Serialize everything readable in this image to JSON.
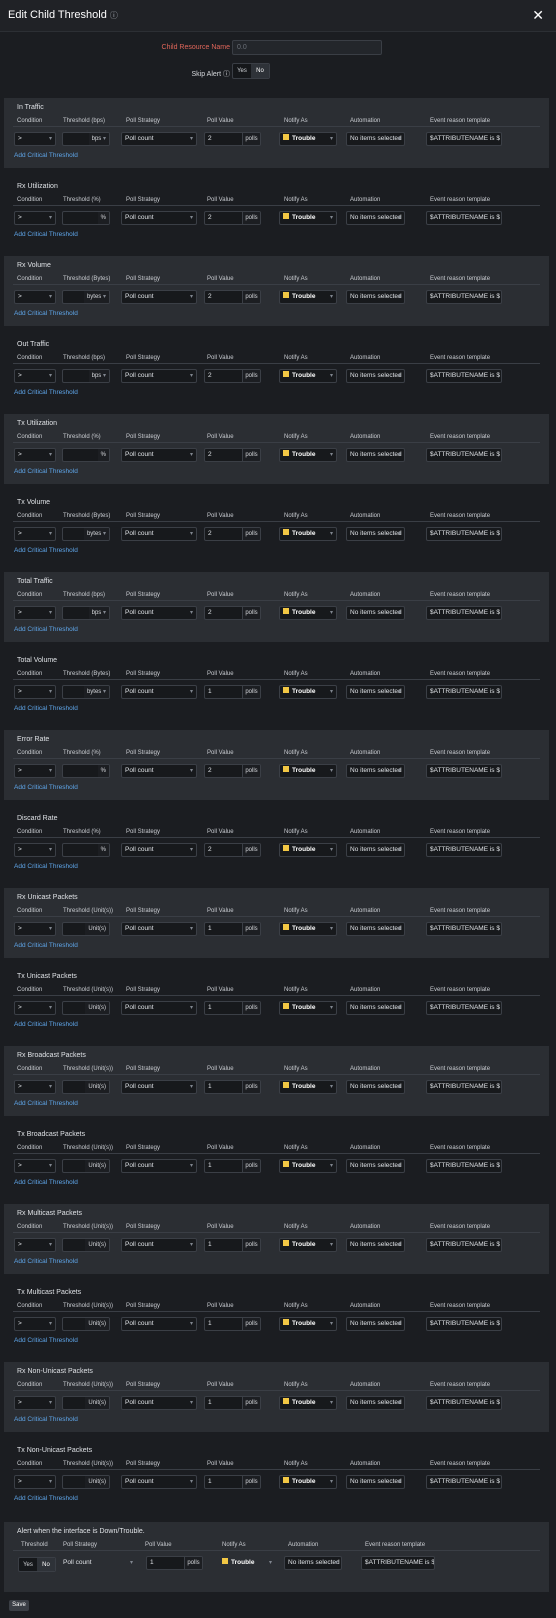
{
  "dialog": {
    "title": "Edit Child Threshold",
    "info_icon": "ⓘ",
    "close_icon": "✕"
  },
  "form": {
    "child_resource_name_label": "Child Resource Name",
    "child_resource_name_value": "0.0",
    "skip_alert_label": "Skip Alert",
    "skip_alert_options": [
      "Yes",
      "No"
    ],
    "skip_alert_selected": "No"
  },
  "columns": {
    "condition": "Condition",
    "poll_strategy": "Poll Strategy",
    "poll_value": "Poll Value",
    "notify_as": "Notify As",
    "automation": "Automation",
    "event_template": "Event reason template"
  },
  "row_defaults": {
    "condition": ">",
    "poll_strategy": "Poll count",
    "polls_unit": "polls",
    "notify_as": "Trouble",
    "notify_color": "#f2c744",
    "automation": "No items selected",
    "event_template": "$ATTRIBUTENAME is $",
    "add_link": "Add Critical Threshold"
  },
  "sections": [
    {
      "title": "In Traffic",
      "threshold_label": "Threshold (bps)",
      "unit": "bps",
      "unit_dropdown": true,
      "poll_value": "2"
    },
    {
      "title": "Rx Utilization",
      "threshold_label": "Threshold (%)",
      "unit": "%",
      "unit_dropdown": false,
      "poll_value": "2"
    },
    {
      "title": "Rx Volume",
      "threshold_label": "Threshold (Bytes)",
      "unit": "bytes",
      "unit_dropdown": true,
      "poll_value": "2"
    },
    {
      "title": "Out Traffic",
      "threshold_label": "Threshold (bps)",
      "unit": "bps",
      "unit_dropdown": true,
      "poll_value": "2"
    },
    {
      "title": "Tx Utilization",
      "threshold_label": "Threshold (%)",
      "unit": "%",
      "unit_dropdown": false,
      "poll_value": "2"
    },
    {
      "title": "Tx Volume",
      "threshold_label": "Threshold (Bytes)",
      "unit": "bytes",
      "unit_dropdown": true,
      "poll_value": "2"
    },
    {
      "title": "Total Traffic",
      "threshold_label": "Threshold (bps)",
      "unit": "bps",
      "unit_dropdown": true,
      "poll_value": "2"
    },
    {
      "title": "Total Volume",
      "threshold_label": "Threshold (Bytes)",
      "unit": "bytes",
      "unit_dropdown": true,
      "poll_value": "1"
    },
    {
      "title": "Error Rate",
      "threshold_label": "Threshold (%)",
      "unit": "%",
      "unit_dropdown": false,
      "poll_value": "2"
    },
    {
      "title": "Discard Rate",
      "threshold_label": "Threshold (%)",
      "unit": "%",
      "unit_dropdown": false,
      "poll_value": "2"
    },
    {
      "title": "Rx Unicast Packets",
      "threshold_label": "Threshold (Unit(s))",
      "unit": "Unit(s)",
      "unit_dropdown": false,
      "poll_value": "1"
    },
    {
      "title": "Tx Unicast Packets",
      "threshold_label": "Threshold (Unit(s))",
      "unit": "Unit(s)",
      "unit_dropdown": false,
      "poll_value": "1"
    },
    {
      "title": "Rx Broadcast Packets",
      "threshold_label": "Threshold (Unit(s))",
      "unit": "Unit(s)",
      "unit_dropdown": false,
      "poll_value": "1"
    },
    {
      "title": "Tx Broadcast Packets",
      "threshold_label": "Threshold (Unit(s))",
      "unit": "Unit(s)",
      "unit_dropdown": false,
      "poll_value": "1"
    },
    {
      "title": "Rx Multicast Packets",
      "threshold_label": "Threshold (Unit(s))",
      "unit": "Unit(s)",
      "unit_dropdown": false,
      "poll_value": "1"
    },
    {
      "title": "Tx Multicast Packets",
      "threshold_label": "Threshold (Unit(s))",
      "unit": "Unit(s)",
      "unit_dropdown": false,
      "poll_value": "1"
    },
    {
      "title": "Rx Non-Unicast Packets",
      "threshold_label": "Threshold (Unit(s))",
      "unit": "Unit(s)",
      "unit_dropdown": false,
      "poll_value": "1"
    },
    {
      "title": "Tx Non-Unicast Packets",
      "threshold_label": "Threshold (Unit(s))",
      "unit": "Unit(s)",
      "unit_dropdown": false,
      "poll_value": "1"
    }
  ],
  "interface_alert": {
    "title": "Alert when the interface is Down/Trouble.",
    "threshold_label": "Threshold",
    "toggle_options": [
      "Yes",
      "No"
    ],
    "toggle_selected": "No",
    "poll_strategy_label": "Poll Strategy",
    "poll_strategy": "Poll count",
    "poll_value_label": "Poll Value",
    "poll_value": "1",
    "polls_unit": "polls",
    "notify_as_label": "Notify As",
    "notify_as": "Trouble",
    "automation_label": "Automation",
    "automation": "No items selected",
    "event_template_label": "Event reason template",
    "event_template": "$ATTRIBUTENAME is $"
  },
  "footer": {
    "save_label": "Save"
  }
}
